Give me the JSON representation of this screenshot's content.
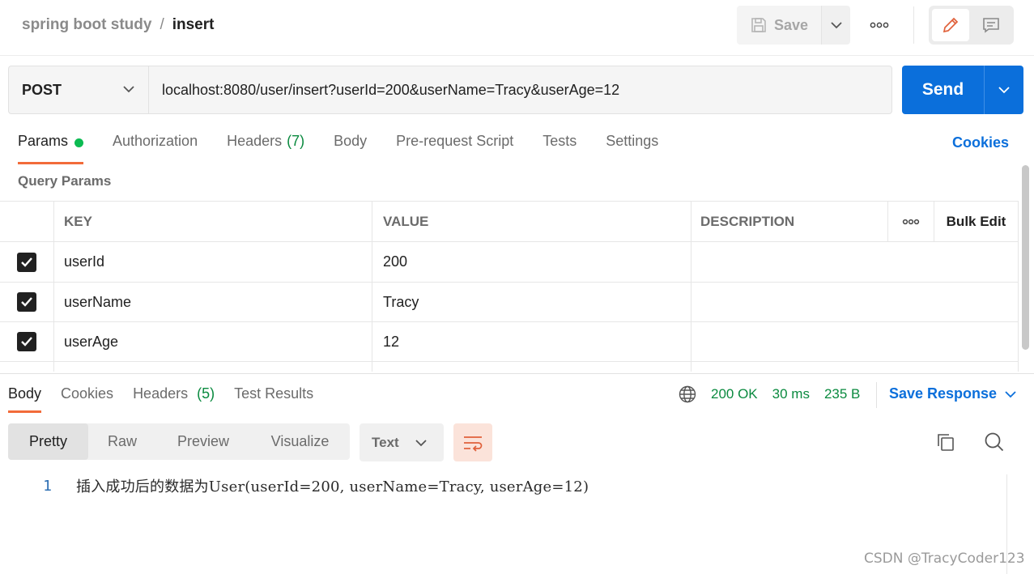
{
  "breadcrumb": {
    "parent": "spring boot study",
    "separator": "/",
    "current": "insert"
  },
  "header": {
    "save_label": "Save"
  },
  "request": {
    "method": "POST",
    "url": "localhost:8080/user/insert?userId=200&userName=Tracy&userAge=12",
    "send_label": "Send"
  },
  "request_tabs": [
    {
      "label": "Params",
      "active": true
    },
    {
      "label": "Authorization"
    },
    {
      "label": "Headers",
      "count": "(7)"
    },
    {
      "label": "Body"
    },
    {
      "label": "Pre-request Script"
    },
    {
      "label": "Tests"
    },
    {
      "label": "Settings"
    }
  ],
  "cookies_label": "Cookies",
  "query_params": {
    "title": "Query Params",
    "columns": {
      "key": "KEY",
      "value": "VALUE",
      "description": "DESCRIPTION",
      "bulk_edit": "Bulk Edit"
    },
    "rows": [
      {
        "checked": true,
        "key": "userId",
        "value": "200",
        "description": ""
      },
      {
        "checked": true,
        "key": "userName",
        "value": "Tracy",
        "description": ""
      },
      {
        "checked": true,
        "key": "userAge",
        "value": "12",
        "description": ""
      }
    ]
  },
  "response_tabs": [
    {
      "label": "Body",
      "active": true
    },
    {
      "label": "Cookies"
    },
    {
      "label": "Headers",
      "count": "(5)"
    },
    {
      "label": "Test Results"
    }
  ],
  "response_status": {
    "status": "200 OK",
    "time": "30 ms",
    "size": "235 B"
  },
  "save_response_label": "Save Response",
  "view_modes": [
    "Pretty",
    "Raw",
    "Preview",
    "Visualize"
  ],
  "active_view_mode": "Pretty",
  "format": "Text",
  "response_body": {
    "line_number": "1",
    "text": "插入成功后的数据为User(userId=200, userName=Tracy, userAge=12)"
  },
  "watermark": "CSDN @TracyCoder123",
  "colors": {
    "accent": "#f26b3a",
    "primary": "#0b6fdb",
    "success": "#0a8a3f",
    "params_dot": "#0cbb52"
  },
  "icons": [
    "save-icon",
    "chevron-down-icon",
    "more-icon",
    "edit-icon",
    "comment-icon",
    "checkbox-icon",
    "globe-icon",
    "wrap-icon",
    "copy-icon",
    "search-icon"
  ]
}
